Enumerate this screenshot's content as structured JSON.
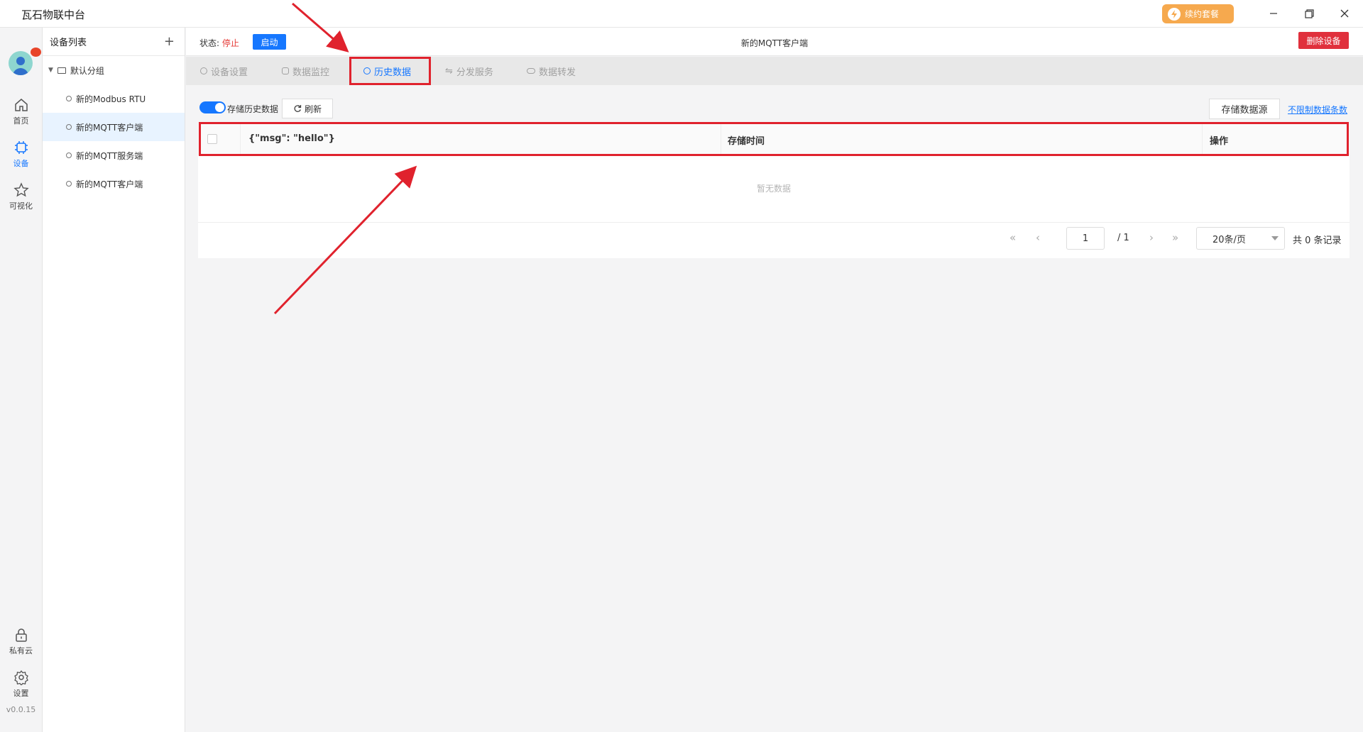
{
  "app": {
    "title": "瓦石物联中台",
    "renew_label": "续约套餐",
    "version": "v0.0.15"
  },
  "rail": {
    "items": [
      {
        "label": "首页",
        "icon": "home-icon"
      },
      {
        "label": "设备",
        "icon": "chip-icon"
      },
      {
        "label": "可视化",
        "icon": "star-icon"
      },
      {
        "label": "私有云",
        "icon": "lock-icon"
      },
      {
        "label": "设置",
        "icon": "gear-icon"
      }
    ]
  },
  "devices": {
    "header": "设备列表",
    "add": "+",
    "group": "默认分组",
    "items": [
      "新的Modbus RTU",
      "新的MQTT客户端",
      "新的MQTT服务端",
      "新的MQTT客户端"
    ]
  },
  "topbar": {
    "status_label": "状态:",
    "status_value": "停止",
    "start": "启动",
    "device_name": "新的MQTT客户端",
    "delete": "删除设备"
  },
  "tabs": [
    "设备设置",
    "数据监控",
    "历史数据",
    "分发服务",
    "数据转发"
  ],
  "toolbar": {
    "store_history": "存储历史数据",
    "refresh": "刷新",
    "source": "存储数据源",
    "limit": "不限制数据条数"
  },
  "table": {
    "columns": [
      "{\"msg\": \"hello\"}",
      "存储时间",
      "操作"
    ],
    "empty": "暂无数据"
  },
  "pager": {
    "page": "1",
    "total_pages": "/ 1",
    "page_size": "20条/页",
    "count": "共 0 条记录"
  },
  "colors": {
    "accent": "#1677ff",
    "danger": "#e0303c",
    "annotation": "#e0222d",
    "renew": "#f6a94e"
  }
}
